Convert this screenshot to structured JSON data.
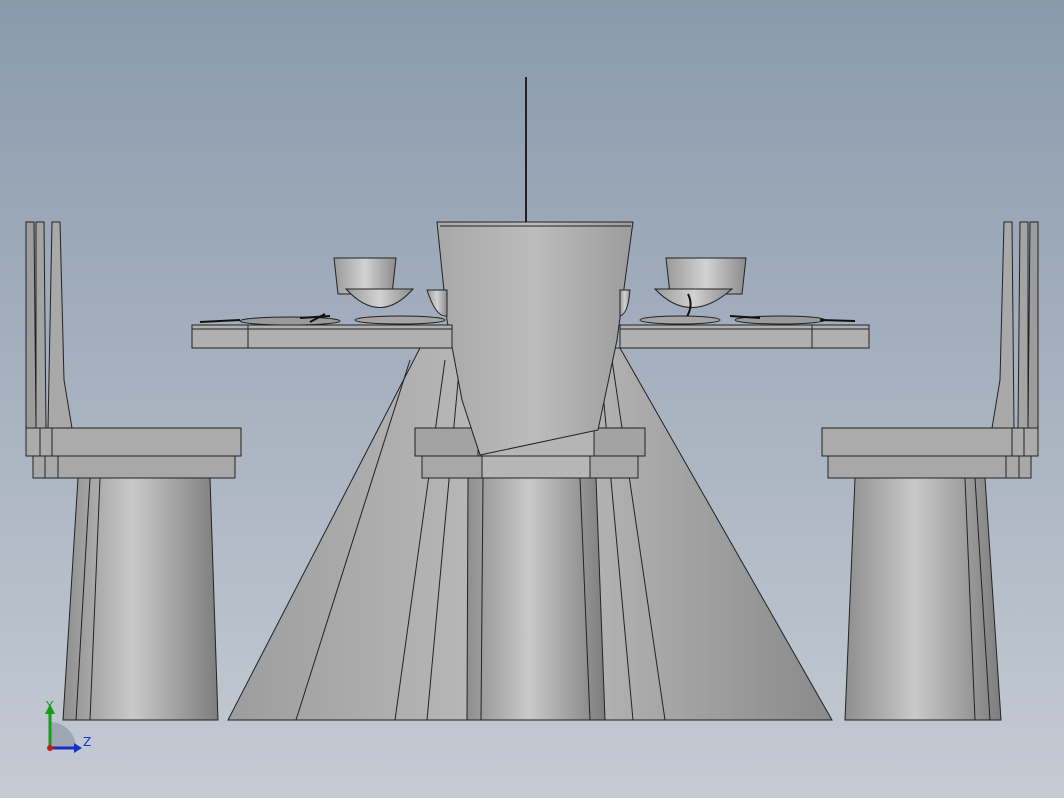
{
  "viewport": {
    "background_top": "#8a9aad",
    "background_bottom": "#c5cbd3",
    "model_color": "#b4b4b4",
    "edge_color": "#222222"
  },
  "triad": {
    "y_label": "Y",
    "z_label": "Z",
    "y_color": "#1a9a1a",
    "z_color": "#1a2fc8",
    "origin_color": "#c81a1a"
  }
}
